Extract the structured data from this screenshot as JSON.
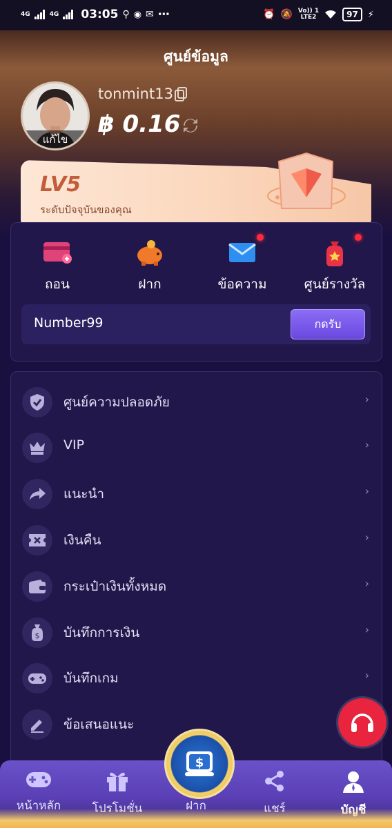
{
  "status_bar": {
    "network_1": "4G",
    "network_2": "4G",
    "time": "03:05",
    "volte": "Vo)) 1",
    "lte": "LTE2",
    "battery": "97"
  },
  "header": {
    "title": "ศูนย์ข้อมูล"
  },
  "profile": {
    "username": "tonmint13",
    "balance": "฿ 0.16",
    "edit_label": "แก้ไข"
  },
  "level": {
    "level": "LV5",
    "description": "ระดับปัจจุบันของคุณ"
  },
  "quick_actions": [
    {
      "label": "ถอน",
      "icon": "withdraw-card-icon"
    },
    {
      "label": "ฝาก",
      "icon": "piggy-bank-icon"
    },
    {
      "label": "ข้อความ",
      "icon": "envelope-icon"
    },
    {
      "label": "ศูนย์รางวัล",
      "icon": "reward-bag-icon"
    }
  ],
  "claim": {
    "name": "Number99",
    "button": "กดรับ"
  },
  "menu": [
    {
      "label": "ศูนย์ความปลอดภัย",
      "icon": "shield-check-icon"
    },
    {
      "label": "VIP",
      "icon": "crown-icon"
    },
    {
      "label": "แนะนำ",
      "icon": "share-arrow-icon"
    },
    {
      "label": "เงินคืน",
      "icon": "ticket-icon"
    },
    {
      "label": "กระเป๋าเงินทั้งหมด",
      "icon": "wallet-icon"
    },
    {
      "label": "บันทึกการเงิน",
      "icon": "money-bag-icon"
    },
    {
      "label": "บันทึกเกม",
      "icon": "gamepad-icon"
    },
    {
      "label": "ข้อเสนอแนะ",
      "icon": "pencil-icon"
    }
  ],
  "menu_chevron": "›",
  "bottom_nav": [
    {
      "label": "หน้าหลัก",
      "icon": "game-controller-icon"
    },
    {
      "label": "โปรโมชั่น",
      "icon": "gift-icon"
    },
    {
      "label": "ฝาก",
      "icon": "deposit-icon"
    },
    {
      "label": "แชร์",
      "icon": "share-icon"
    },
    {
      "label": "บัญชี",
      "icon": "account-icon"
    }
  ],
  "colors": {
    "accent": "#7b5cf0",
    "panel": "#22174a",
    "notification": "#ff2a3d",
    "support": "#e8243f"
  }
}
